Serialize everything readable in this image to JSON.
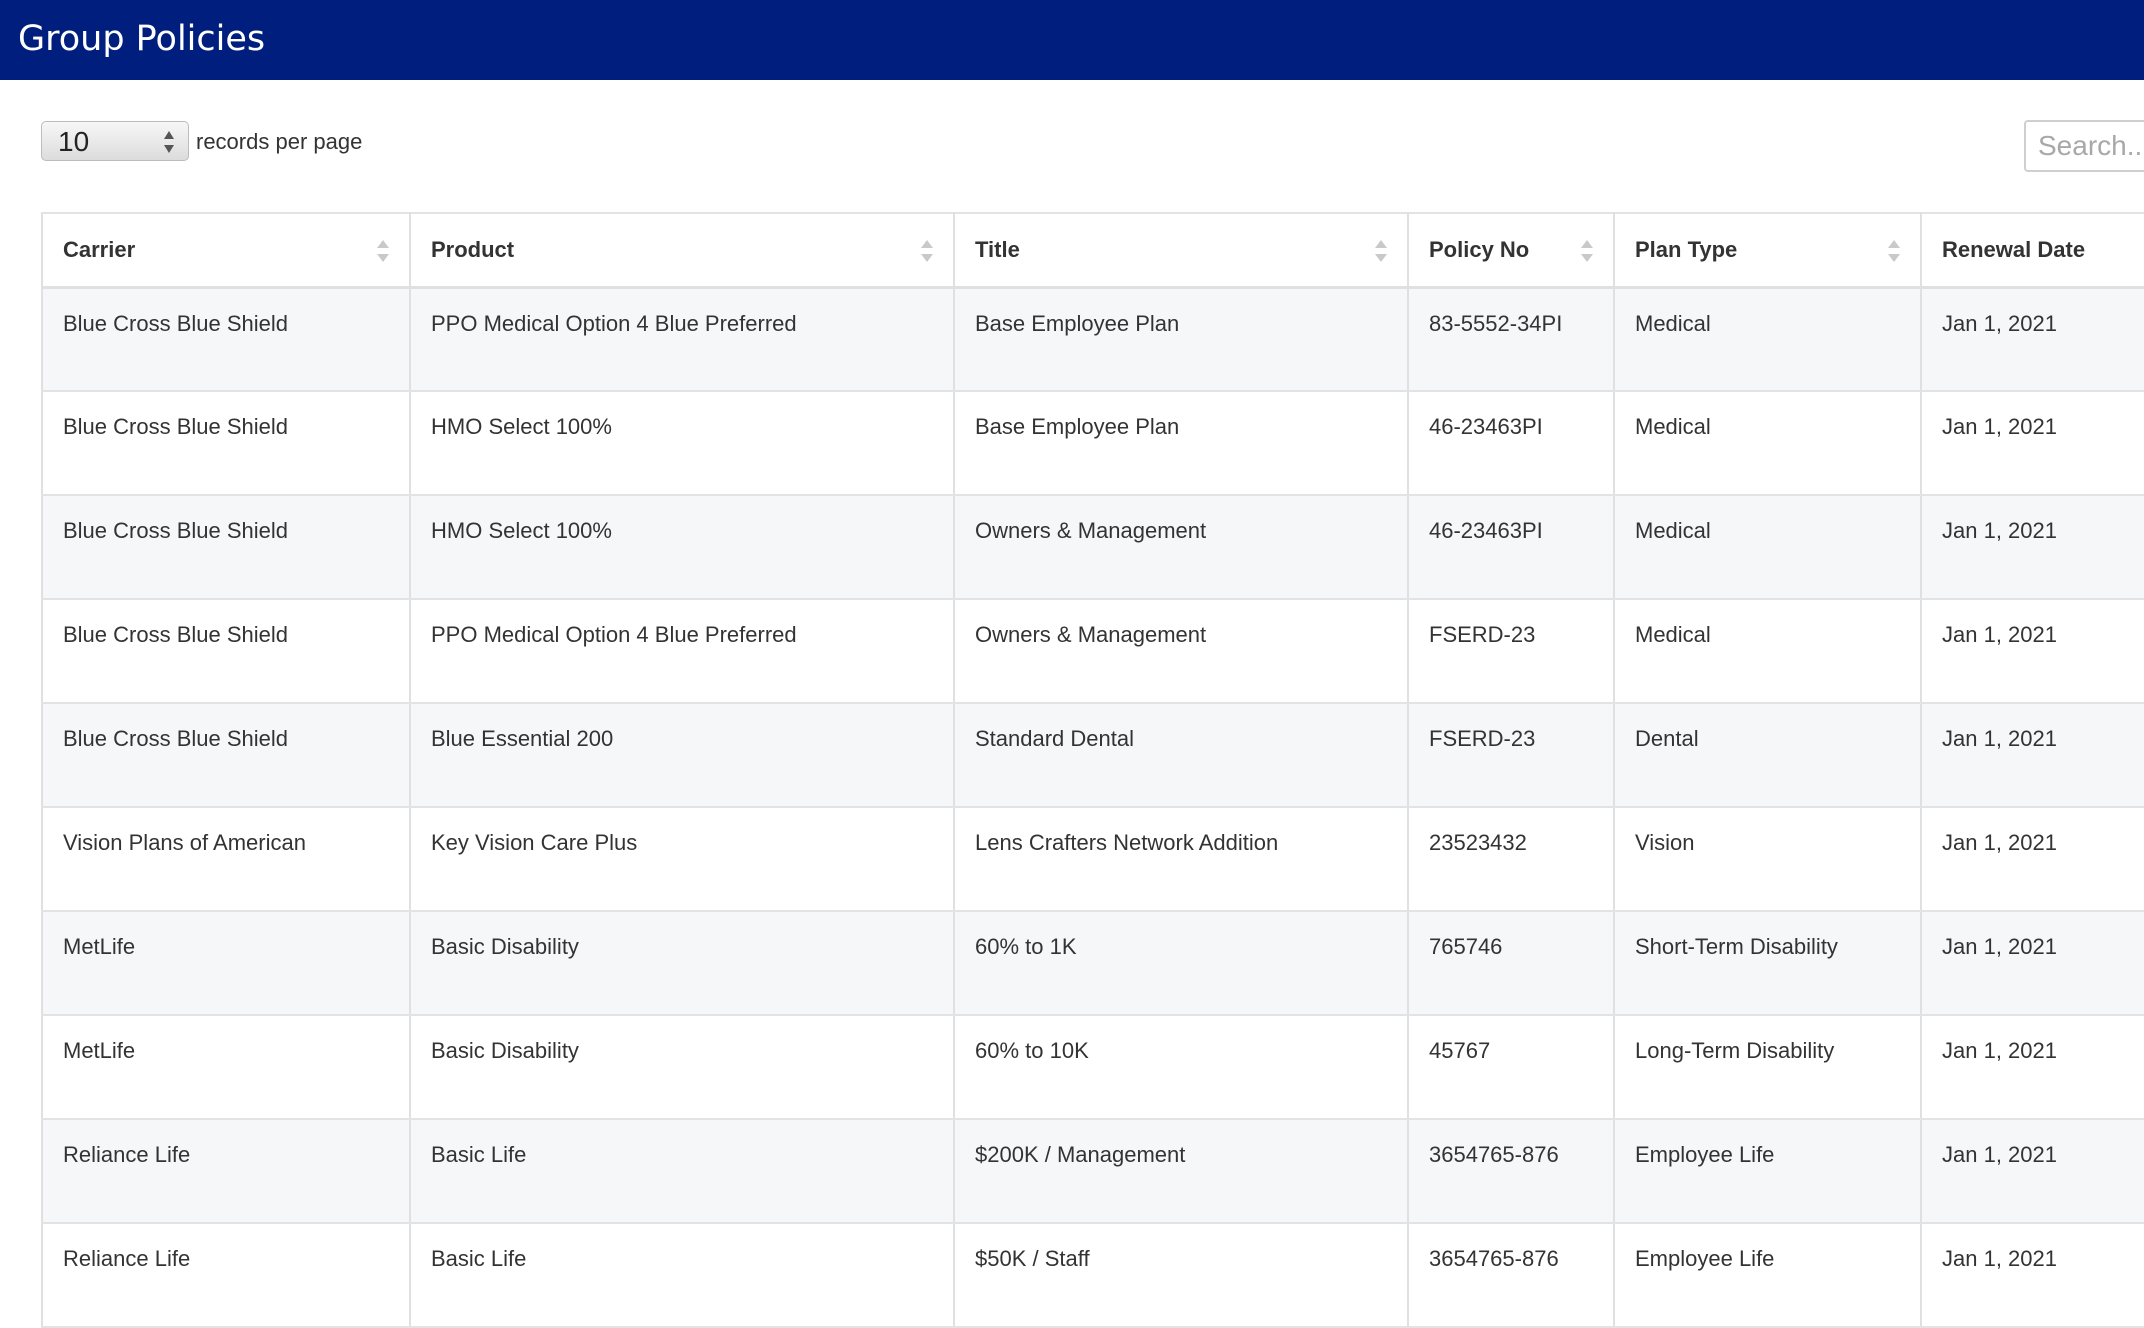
{
  "header": {
    "title": "Group Policies"
  },
  "controls": {
    "page_size": "10",
    "records_label": "records per page",
    "search_placeholder": "Search..."
  },
  "table": {
    "columns": [
      {
        "label": "Carrier",
        "key": "carrier"
      },
      {
        "label": "Product",
        "key": "product"
      },
      {
        "label": "Title",
        "key": "title"
      },
      {
        "label": "Policy No",
        "key": "policy_no"
      },
      {
        "label": "Plan Type",
        "key": "plan_type"
      },
      {
        "label": "Renewal Date",
        "key": "renewal_date"
      }
    ],
    "rows": [
      {
        "carrier": "Blue Cross Blue Shield",
        "product": "PPO Medical Option 4 Blue Preferred",
        "title": "Base Employee Plan",
        "policy_no": "83-5552-34PI",
        "plan_type": "Medical",
        "renewal_date": "Jan 1, 2021"
      },
      {
        "carrier": "Blue Cross Blue Shield",
        "product": "HMO Select 100%",
        "title": "Base Employee Plan",
        "policy_no": "46-23463PI",
        "plan_type": "Medical",
        "renewal_date": "Jan 1, 2021"
      },
      {
        "carrier": "Blue Cross Blue Shield",
        "product": "HMO Select 100%",
        "title": "Owners & Management",
        "policy_no": "46-23463PI",
        "plan_type": "Medical",
        "renewal_date": "Jan 1, 2021"
      },
      {
        "carrier": "Blue Cross Blue Shield",
        "product": "PPO Medical Option 4 Blue Preferred",
        "title": "Owners & Management",
        "policy_no": "FSERD-23",
        "plan_type": "Medical",
        "renewal_date": "Jan 1, 2021"
      },
      {
        "carrier": "Blue Cross Blue Shield",
        "product": "Blue Essential 200",
        "title": "Standard Dental",
        "policy_no": "FSERD-23",
        "plan_type": "Dental",
        "renewal_date": "Jan 1, 2021"
      },
      {
        "carrier": "Vision Plans of American",
        "product": "Key Vision Care Plus",
        "title": "Lens Crafters Network Addition",
        "policy_no": "23523432",
        "plan_type": "Vision",
        "renewal_date": "Jan 1, 2021"
      },
      {
        "carrier": "MetLife",
        "product": "Basic Disability",
        "title": "60% to 1K",
        "policy_no": "765746",
        "plan_type": "Short-Term Disability",
        "renewal_date": "Jan 1, 2021"
      },
      {
        "carrier": "MetLife",
        "product": "Basic Disability",
        "title": "60% to 10K",
        "policy_no": "45767",
        "plan_type": "Long-Term Disability",
        "renewal_date": "Jan 1, 2021"
      },
      {
        "carrier": "Reliance Life",
        "product": "Basic Life",
        "title": "$200K / Management",
        "policy_no": "3654765-876",
        "plan_type": "Employee Life",
        "renewal_date": "Jan 1, 2021"
      },
      {
        "carrier": "Reliance Life",
        "product": "Basic Life",
        "title": "$50K / Staff",
        "policy_no": "3654765-876",
        "plan_type": "Employee Life",
        "renewal_date": "Jan 1, 2021"
      }
    ]
  },
  "icons": {
    "page_size_stepper": "up-down-arrows-icon",
    "column_sort": "sort-both-icon"
  },
  "colors": {
    "header_bg": "#001e7e",
    "header_text": "#ffffff",
    "row_stripe": "#f6f7f9",
    "border": "#e0e0e0"
  }
}
